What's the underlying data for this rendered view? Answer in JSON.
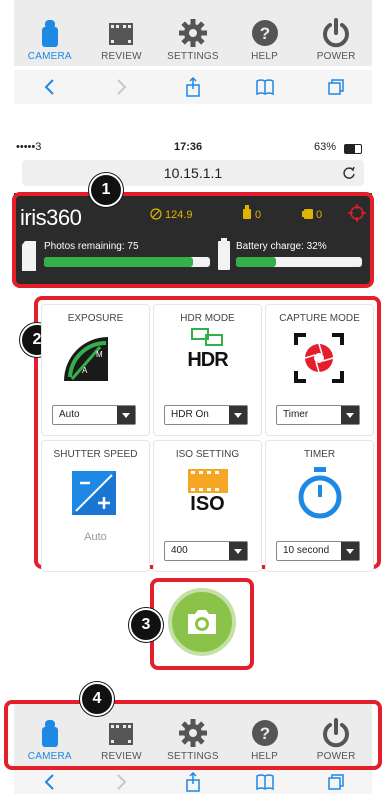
{
  "nav": {
    "items": [
      {
        "label": "CAMERA",
        "icon": "camera-icon",
        "active": true
      },
      {
        "label": "REVIEW",
        "icon": "film-icon",
        "active": false
      },
      {
        "label": "SETTINGS",
        "icon": "gear-icon",
        "active": false
      },
      {
        "label": "HELP",
        "icon": "help-icon",
        "active": false
      },
      {
        "label": "POWER",
        "icon": "power-icon",
        "active": false
      }
    ]
  },
  "status": {
    "signal": "•••••3",
    "time": "17:36",
    "battery": "63%"
  },
  "url": "10.15.1.1",
  "badges": [
    "1",
    "2",
    "3",
    "4"
  ],
  "panel": {
    "logo": "iris360",
    "gauge_value": "124.9",
    "count_a": "0",
    "count_b": "0",
    "photos_label": "Photos remaining: 75",
    "photos_fill": 0.9,
    "battery_label": "Battery charge: 32%",
    "battery_fill": 0.32
  },
  "controls": [
    {
      "title": "EXPOSURE",
      "icon": "exposure-dial-icon",
      "value": "Auto",
      "type": "select"
    },
    {
      "title": "HDR MODE",
      "icon": "hdr-icon",
      "value": "HDR On",
      "type": "select"
    },
    {
      "title": "CAPTURE MODE",
      "icon": "shutter-icon",
      "value": "Timer",
      "type": "select"
    },
    {
      "title": "SHUTTER SPEED",
      "icon": "exposure-plus-icon",
      "value": "Auto",
      "type": "text"
    },
    {
      "title": "ISO SETTING",
      "icon": "iso-film-icon",
      "value": "400",
      "type": "select"
    },
    {
      "title": "TIMER",
      "icon": "stopwatch-icon",
      "value": "10 second",
      "type": "select"
    }
  ],
  "icon_text": {
    "hdr": "HDR",
    "iso": "ISO"
  },
  "colors": {
    "accent": "#1e88e5",
    "alert": "#e41e2b",
    "ok": "#33b04a",
    "capture": "#8bc34a"
  }
}
